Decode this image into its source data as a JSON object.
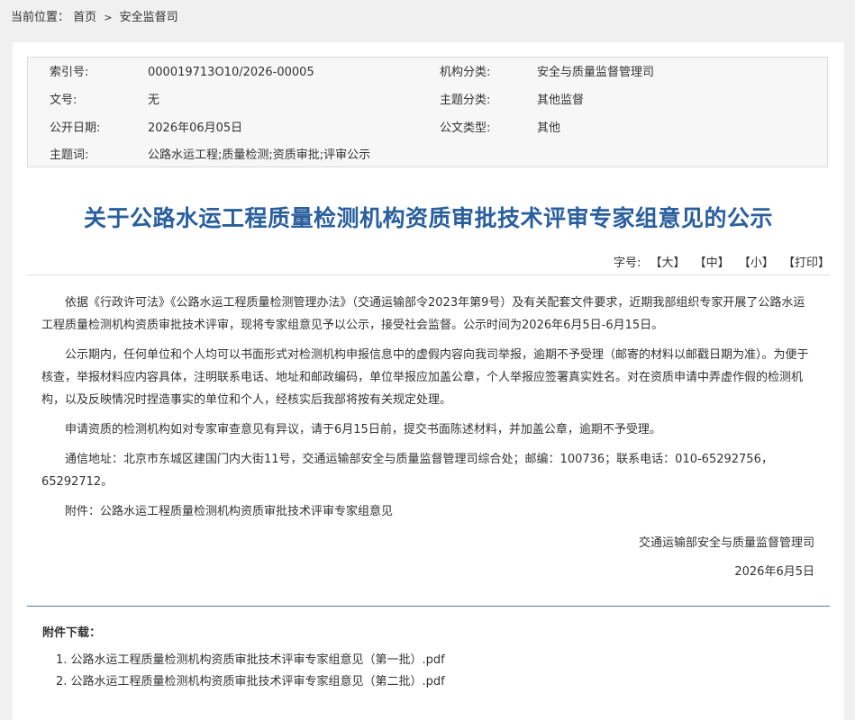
{
  "breadcrumb": {
    "label": "当前位置：",
    "home": "首页",
    "separator": ">",
    "current": "安全监督司"
  },
  "meta": {
    "index_label": "索引号:",
    "index_value": "000019713O10/2026-00005",
    "org_label": "机构分类:",
    "org_value": "安全与质量监督管理司",
    "docno_label": "文号:",
    "docno_value": "无",
    "topic_label": "主题分类:",
    "topic_value": "其他监督",
    "date_label": "公开日期:",
    "date_value": "2026年06月05日",
    "type_label": "公文类型:",
    "type_value": "其他",
    "keywords_label": "主题词:",
    "keywords_value": "公路水运工程;质量检测;资质审批;评审公示"
  },
  "title": "关于公路水运工程质量检测机构资质审批技术评审专家组意见的公示",
  "fontsize": {
    "label": "字号:",
    "large": "【大】",
    "medium": "【中】",
    "small": "【小】",
    "print": "【打印】"
  },
  "content": {
    "p1": "依据《行政许可法》《公路水运工程质量检测管理办法》（交通运输部令2023年第9号）及有关配套文件要求，近期我部组织专家开展了公路水运工程质量检测机构资质审批技术评审，现将专家组意见予以公示，接受社会监督。公示时间为2026年6月5日-6月15日。",
    "p2": "公示期内，任何单位和个人均可以书面形式对检测机构申报信息中的虚假内容向我司举报，逾期不予受理（邮寄的材料以邮戳日期为准）。为便于核查，举报材料应内容具体，注明联系电话、地址和邮政编码，单位举报应加盖公章，个人举报应签署真实姓名。对在资质申请中弄虚作假的检测机构，以及反映情况时捏造事实的单位和个人，经核实后我部将按有关规定处理。",
    "p3": "申请资质的检测机构如对专家审查意见有异议，请于6月15日前，提交书面陈述材料，并加盖公章，逾期不予受理。",
    "p4": "通信地址：北京市东城区建国门内大街11号，交通运输部安全与质量监督管理司综合处；邮编：100736；联系电话：010-65292756，65292712。",
    "p5": "附件：公路水运工程质量检测机构资质审批技术评审专家组意见"
  },
  "signature": {
    "org": "交通运输部安全与质量监督管理司",
    "date": "2026年6月5日"
  },
  "attachments": {
    "title": "附件下载：",
    "items": [
      "1. 公路水运工程质量检测机构资质审批技术评审专家组意见（第一批）.pdf",
      "2. 公路水运工程质量检测机构资质审批技术评审专家组意见（第二批）.pdf"
    ]
  },
  "colors": {
    "title": "#2a5f9e",
    "page_bg": "#f0f0f0",
    "meta_bg": "#f7f7f7"
  }
}
